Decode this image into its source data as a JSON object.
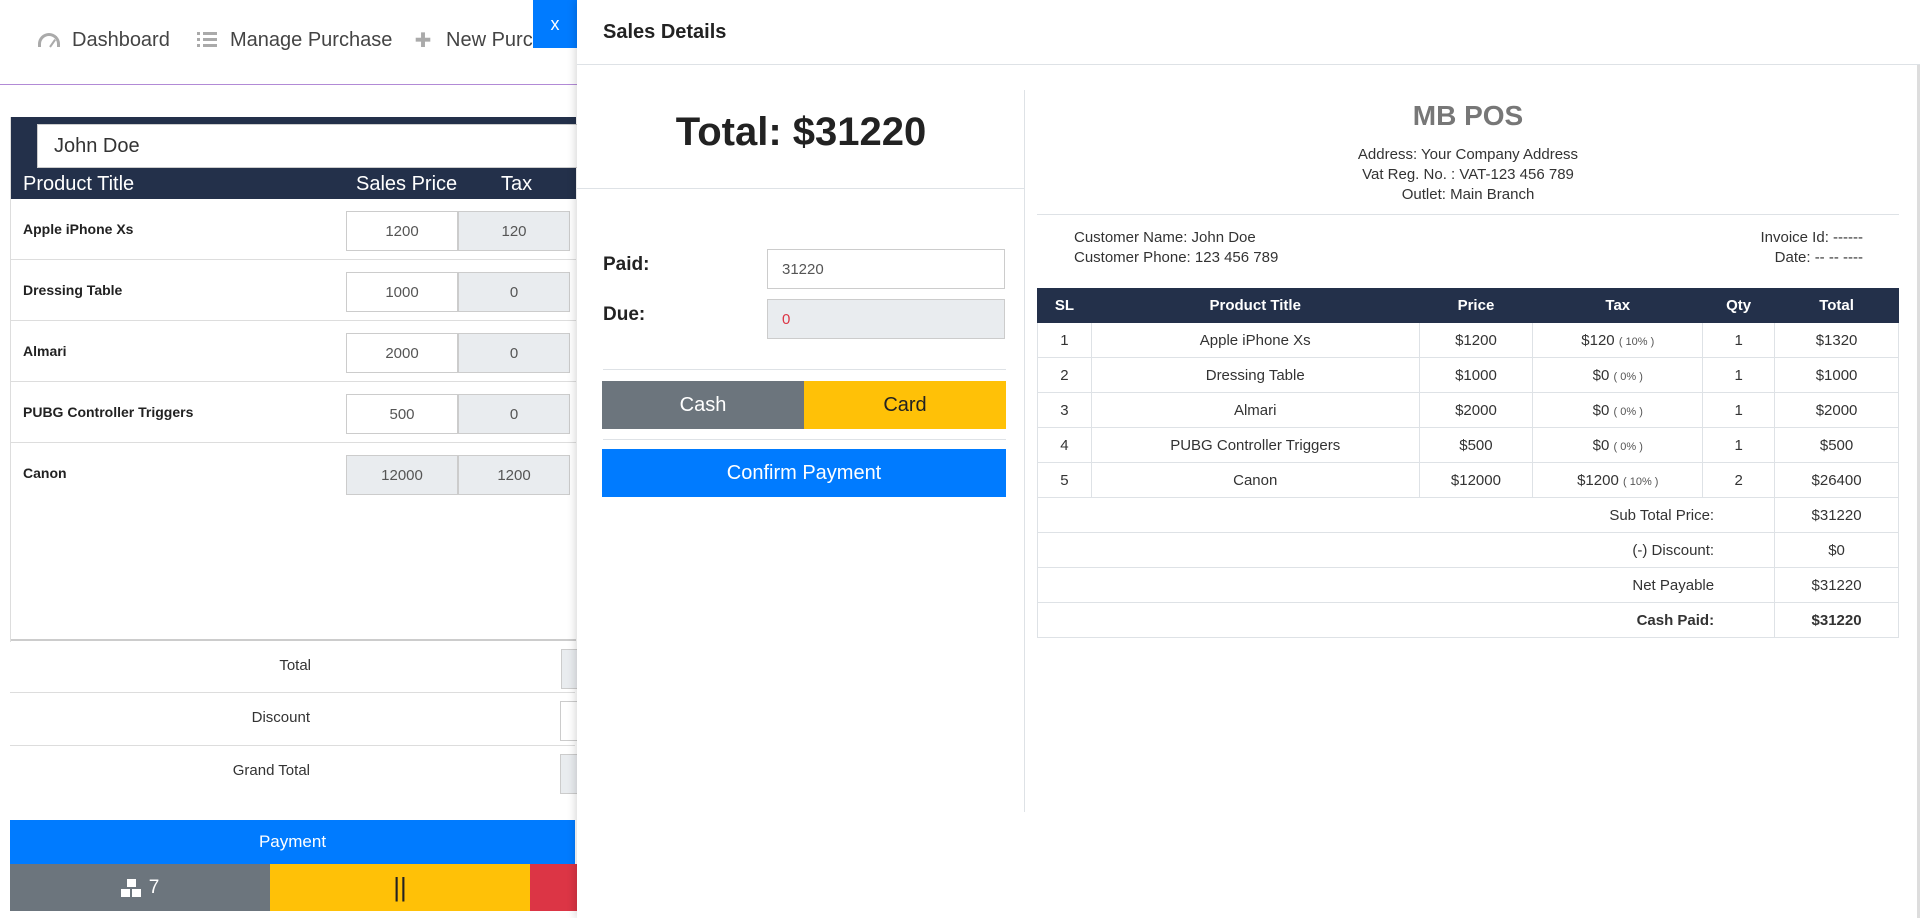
{
  "nav": {
    "items": [
      {
        "label": "Dashboard",
        "icon": "dashboard-icon"
      },
      {
        "label": "Manage Purchase",
        "icon": "list-icon"
      },
      {
        "label": "New Purchase",
        "icon": "plus-icon"
      }
    ]
  },
  "pos": {
    "customer": "John Doe",
    "columns": [
      "Product Title",
      "Sales Price",
      "Tax"
    ],
    "rows": [
      {
        "title": "Apple iPhone Xs",
        "price": "1200",
        "tax": "120"
      },
      {
        "title": "Dressing Table",
        "price": "1000",
        "tax": "0"
      },
      {
        "title": "Almari",
        "price": "2000",
        "tax": "0"
      },
      {
        "title": "PUBG Controller Triggers",
        "price": "500",
        "tax": "0"
      },
      {
        "title": "Canon",
        "price": "12000",
        "tax": "1200"
      }
    ],
    "summary": [
      "Total",
      "Discount",
      "Grand Total"
    ],
    "payment_label": "Payment",
    "item_count": "7",
    "hold_label": "||"
  },
  "modal": {
    "close_label": "x",
    "title": "Sales Details",
    "total_text": "Total: $31220",
    "paid_label": "Paid:",
    "paid_value": "31220",
    "due_label": "Due:",
    "due_value": "0",
    "cash_label": "Cash",
    "card_label": "Card",
    "confirm_label": "Confirm Payment"
  },
  "invoice": {
    "company": "MB POS",
    "address": "Address: Your Company Address",
    "vat": "Vat Reg. No. : VAT-123 456 789",
    "outlet": "Outlet: Main Branch",
    "customer_name": "Customer Name: John Doe",
    "customer_phone": "Customer Phone: 123 456 789",
    "invoice_id": "Invoice Id: ------",
    "date": "Date: -- -- ----",
    "columns": [
      "SL",
      "Product Title",
      "Price",
      "Tax",
      "Qty",
      "Total"
    ],
    "rows": [
      {
        "sl": "1",
        "title": "Apple iPhone Xs",
        "price": "$1200",
        "tax": "$120",
        "tax_pct": "( 10% )",
        "qty": "1",
        "total": "$1320"
      },
      {
        "sl": "2",
        "title": "Dressing Table",
        "price": "$1000",
        "tax": "$0",
        "tax_pct": "( 0% )",
        "qty": "1",
        "total": "$1000"
      },
      {
        "sl": "3",
        "title": "Almari",
        "price": "$2000",
        "tax": "$0",
        "tax_pct": "( 0% )",
        "qty": "1",
        "total": "$2000"
      },
      {
        "sl": "4",
        "title": "PUBG Controller Triggers",
        "price": "$500",
        "tax": "$0",
        "tax_pct": "( 0% )",
        "qty": "1",
        "total": "$500"
      },
      {
        "sl": "5",
        "title": "Canon",
        "price": "$12000",
        "tax": "$1200",
        "tax_pct": "( 10% )",
        "qty": "2",
        "total": "$26400"
      }
    ],
    "subtotal_label": "Sub Total Price:",
    "subtotal": "$31220",
    "discount_label": "(-) Discount:",
    "discount": "$0",
    "net_label": "Net Payable",
    "net": "$31220",
    "cash_paid_label": "Cash Paid:",
    "cash_paid": "$31220"
  }
}
